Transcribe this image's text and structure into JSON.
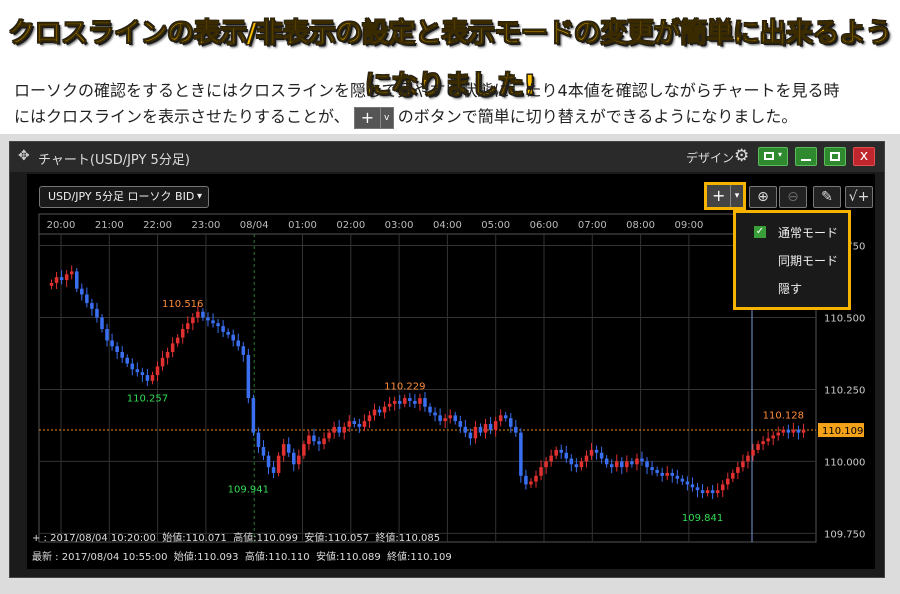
{
  "headline": "クロスラインの表示/非表示の設定と表示モードの変更が簡単に出来るようになりました!",
  "description": {
    "line1": "ローソクの確認をするときにはクロスラインを隠して見やすい状態にしたり4本値を確認しながらチャートを見る時",
    "line2_before": "にはクロスラインを表示させたりすることが、",
    "line2_after": "のボタンで簡単に切り替えができるようになりました。",
    "button_glyph": "+",
    "button_chevron": "v"
  },
  "window": {
    "title": "チャート(USD/JPY 5分足)",
    "design_label": "デザイン",
    "close_glyph": "x"
  },
  "toolbar": {
    "symbol_select": "USD/JPY 5分足 ローソク BID",
    "cross_glyph": "+",
    "zoom_in_glyph": "⊕",
    "zoom_out_glyph": "⊖",
    "pen_glyph": "✎",
    "indicator_glyph": "√+"
  },
  "crossline_menu": {
    "items": [
      {
        "label": "通常モード",
        "checked": true
      },
      {
        "label": "同期モード",
        "checked": false
      },
      {
        "label": "隠す",
        "checked": false
      }
    ],
    "check_glyph": "✓"
  },
  "info_bars": {
    "cursor": "+ : 2017/08/04 10:20:00  始値:110.071  高値:110.099  安値:110.057  終値:110.085",
    "latest": "最新 : 2017/08/04 10:55:00  始値:110.093  高値:110.110  安値:110.089  終値:110.109"
  },
  "chart_data": {
    "type": "candlestick",
    "time_labels": [
      "20:00",
      "21:00",
      "22:00",
      "23:00",
      "08/04",
      "01:00",
      "02:00",
      "03:00",
      "04:00",
      "05:00",
      "06:00",
      "07:00",
      "08:00",
      "09:00"
    ],
    "price_ticks": [
      "110.750",
      "110.500",
      "110.250",
      "110.000",
      "109.750"
    ],
    "ylim": [
      109.72,
      110.79
    ],
    "current_price": "110.109",
    "annotations": [
      {
        "label": "110.516",
        "kind": "high",
        "color": "#ff8c3a",
        "x_index": 26,
        "price": 110.516
      },
      {
        "label": "110.257",
        "kind": "low",
        "color": "#33dd55",
        "x_index": 19,
        "price": 110.257
      },
      {
        "label": "110.229",
        "kind": "high",
        "color": "#ff8c3a",
        "x_index": 70,
        "price": 110.229
      },
      {
        "label": "109.941",
        "kind": "low",
        "color": "#33dd55",
        "x_index": 39,
        "price": 109.941
      },
      {
        "label": "110.128",
        "kind": "high",
        "color": "#ff8c3a",
        "x_index": 145,
        "price": 110.128
      },
      {
        "label": "109.841",
        "kind": "low",
        "color": "#33dd55",
        "x_index": 129,
        "price": 109.841
      }
    ],
    "up_color": "#e03030",
    "down_color": "#3a6ff0",
    "closes": [
      110.62,
      110.64,
      110.63,
      110.65,
      110.66,
      110.6,
      110.58,
      110.55,
      110.53,
      110.5,
      110.46,
      110.42,
      110.4,
      110.38,
      110.36,
      110.34,
      110.32,
      110.31,
      110.3,
      110.28,
      110.3,
      110.33,
      110.36,
      110.38,
      110.41,
      110.43,
      110.46,
      110.48,
      110.5,
      110.52,
      110.5,
      110.49,
      110.48,
      110.47,
      110.45,
      110.44,
      110.42,
      110.4,
      110.37,
      110.22,
      110.1,
      110.05,
      110.02,
      109.98,
      109.96,
      110.02,
      110.06,
      110.03,
      109.99,
      110.02,
      110.06,
      110.09,
      110.07,
      110.06,
      110.08,
      110.1,
      110.12,
      110.1,
      110.12,
      110.14,
      110.13,
      110.12,
      110.14,
      110.16,
      110.18,
      110.17,
      110.19,
      110.2,
      110.21,
      110.2,
      110.22,
      110.21,
      110.2,
      110.22,
      110.19,
      110.17,
      110.16,
      110.14,
      110.15,
      110.16,
      110.14,
      110.12,
      110.1,
      110.08,
      110.12,
      110.1,
      110.13,
      110.11,
      110.14,
      110.16,
      110.15,
      110.12,
      110.1,
      109.95,
      109.92,
      109.93,
      109.95,
      109.98,
      110.0,
      110.02,
      110.04,
      110.03,
      110.01,
      109.99,
      109.98,
      110.0,
      110.02,
      110.04,
      110.03,
      110.01,
      109.99,
      109.98,
      110.0,
      109.98,
      110.0,
      109.99,
      110.01,
      110.0,
      109.98,
      109.97,
      109.96,
      109.95,
      109.96,
      109.95,
      109.94,
      109.93,
      109.92,
      109.91,
      109.9,
      109.89,
      109.9,
      109.89,
      109.9,
      109.92,
      109.94,
      109.96,
      109.98,
      110.0,
      110.02,
      110.04,
      110.06,
      110.07,
      110.08,
      110.09,
      110.1,
      110.11,
      110.1,
      110.11,
      110.1,
      110.11
    ]
  }
}
